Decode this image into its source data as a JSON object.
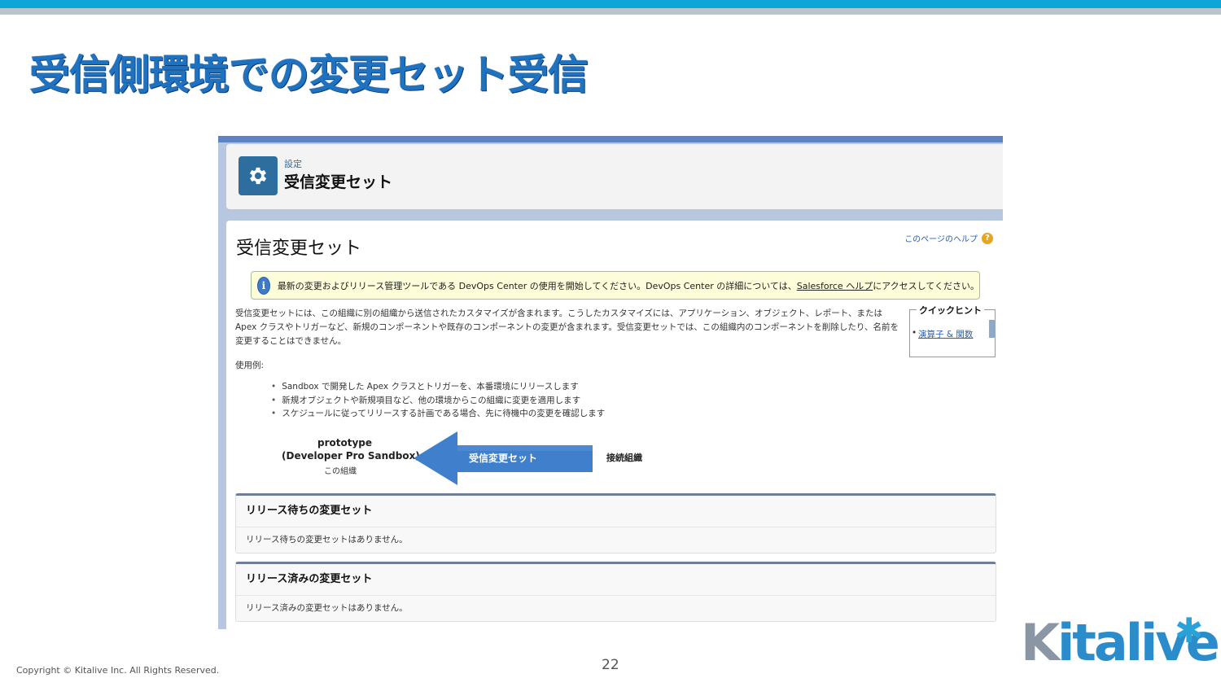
{
  "slide": {
    "title": "受信側環境での変更セット受信",
    "page_number": "22",
    "copyright": "Copyright © Kitalive Inc. All Rights Reserved.",
    "logo_main": "italive",
    "logo_k": "K",
    "logo_star": "✱"
  },
  "screenshot": {
    "header": {
      "breadcrumb": "設定",
      "title": "受信変更セット",
      "icon": "gear-icon"
    },
    "page_title": "受信変更セット",
    "help_link": "このページのヘルプ",
    "help_icon": "?",
    "info": {
      "icon_text": "i",
      "text_before": "最新の変更およびリリース管理ツールである DevOps Center の使用を開始してください。DevOps Center の詳細については、",
      "link": "Salesforce ヘルプ",
      "text_after": "にアクセスしてください。"
    },
    "description": "受信変更セットには、この組織に別の組織から送信されたカスタマイズが含まれます。こうしたカスタマイズには、アプリケーション、オブジェクト、レポート、または Apex クラスやトリガーなど、新規のコンポーネントや既存のコンポーネントの変更が含まれます。受信変更セットでは、この組織内のコンポーネントを削除したり、名前を変更することはできません。",
    "quick_hint": {
      "title": "クイックヒント",
      "item": "演算子 & 関数"
    },
    "usage_label": "使用例:",
    "usage_items": [
      "Sandbox で開発した Apex クラスとトリガーを、本番環境にリリースします",
      "新規オブジェクトや新規項目など、他の環境からこの組織に変更を適用します",
      "スケジュールに従ってリリースする計画である場合、先に待機中の変更を確認します"
    ],
    "diagram": {
      "target_line1": "prototype",
      "target_line2": "(Developer Pro Sandbox)",
      "target_line3": "この組織",
      "arrow_label": "受信変更セット",
      "source": "接続組織",
      "arrow_color": "#3f7fcc"
    },
    "sections": [
      {
        "title": "リリース待ちの変更セット",
        "body": "リリース待ちの変更セットはありません。"
      },
      {
        "title": "リリース済みの変更セット",
        "body": "リリース済みの変更セットはありません。"
      }
    ]
  },
  "colors": {
    "accent": "#0ea5d8",
    "title": "#1e72c0",
    "header_icon_bg": "#2d6e9e"
  }
}
